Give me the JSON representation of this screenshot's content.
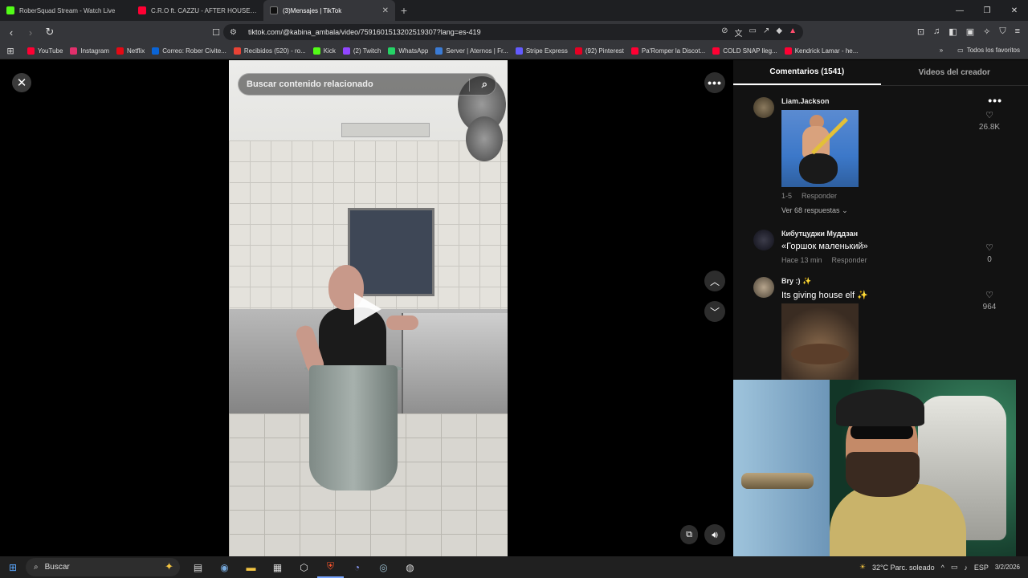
{
  "browser": {
    "tabs": [
      {
        "label": "RoberSquad Stream - Watch Live",
        "color": "#53fc18",
        "active": false
      },
      {
        "label": "C.R.O ft. CAZZU - AFTER HOUSE (Offi",
        "color": "#ff0033",
        "active": false
      },
      {
        "label": "(3)Mensajes | TikTok",
        "color": "#ffffff",
        "active": true
      }
    ],
    "url": "tiktok.com/@kabina_ambala/video/7591601513202519307?lang=es-419",
    "bookmarks": [
      {
        "label": "YouTube",
        "color": "#ff0033"
      },
      {
        "label": "Instagram",
        "color": "#e1306c"
      },
      {
        "label": "Netflix",
        "color": "#e50914"
      },
      {
        "label": "Correo: Rober Civite...",
        "color": "#0a64d6"
      },
      {
        "label": "Recibidos (520) - ro...",
        "color": "#ea4335"
      },
      {
        "label": "Kick",
        "color": "#53fc18"
      },
      {
        "label": "(2) Twitch",
        "color": "#9146ff"
      },
      {
        "label": "WhatsApp",
        "color": "#25d366"
      },
      {
        "label": "Server | Aternos | Fr...",
        "color": "#3a7bd5"
      },
      {
        "label": "Stripe Express",
        "color": "#635bff"
      },
      {
        "label": "(92) Pinterest",
        "color": "#e60023"
      },
      {
        "label": "Pa'Romper la Discot...",
        "color": "#ff0033"
      },
      {
        "label": "COLD SNAP lleg...",
        "color": "#ff0033"
      },
      {
        "label": "Kendrick Lamar - he...",
        "color": "#ff0033"
      }
    ],
    "all_bookmarks_label": "Todos los favoritos"
  },
  "tiktok": {
    "search_placeholder": "Buscar contenido relacionado",
    "tabs": {
      "comments": "Comentarios (1541)",
      "creator_videos": "Videos del creador"
    },
    "comments": [
      {
        "user": "Liam.Jackson",
        "text": "",
        "has_gif": true,
        "meta_time": "1-5",
        "reply_label": "Responder",
        "replies": "Ver 68 respuestas",
        "likes": "26.8K"
      },
      {
        "user": "Кибутцуджи Муддзан",
        "text": "«Горшок маленький»",
        "has_gif": false,
        "meta_time": "Hace 13 min",
        "reply_label": "Responder",
        "replies": "",
        "likes": "0"
      },
      {
        "user": "Bry :)",
        "text": "Its giving house elf",
        "has_gif": true,
        "meta_time": "",
        "reply_label": "",
        "replies": "",
        "likes": "964"
      }
    ]
  },
  "taskbar": {
    "search_label": "Buscar",
    "weather": "32°C  Parc. soleado",
    "language": "ESP",
    "date": "3/2/2026"
  }
}
